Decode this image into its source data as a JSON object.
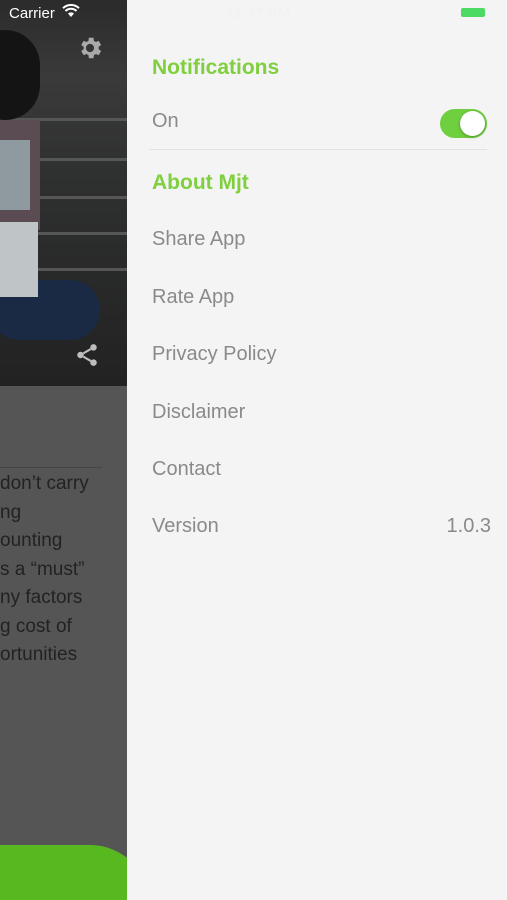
{
  "status_bar": {
    "carrier": "Carrier",
    "time": "11:47 AM"
  },
  "background": {
    "article_lines": [
      "don’t carry",
      "ng",
      "ounting",
      "s a “must”",
      "ny factors",
      "g cost of",
      "ortunities"
    ]
  },
  "drawer": {
    "notifications_title": "Notifications",
    "notifications_on_label": "On",
    "about_title": "About Mjt",
    "items": [
      {
        "label": "Share App"
      },
      {
        "label": "Rate App"
      },
      {
        "label": "Privacy Policy"
      },
      {
        "label": "Disclaimer"
      },
      {
        "label": "Contact"
      }
    ],
    "version_label": "Version",
    "version_value": "1.0.3"
  },
  "colors": {
    "accent": "#7fcf3f",
    "toggle_on": "#6fd03f",
    "text_muted": "#8a8a8a"
  }
}
